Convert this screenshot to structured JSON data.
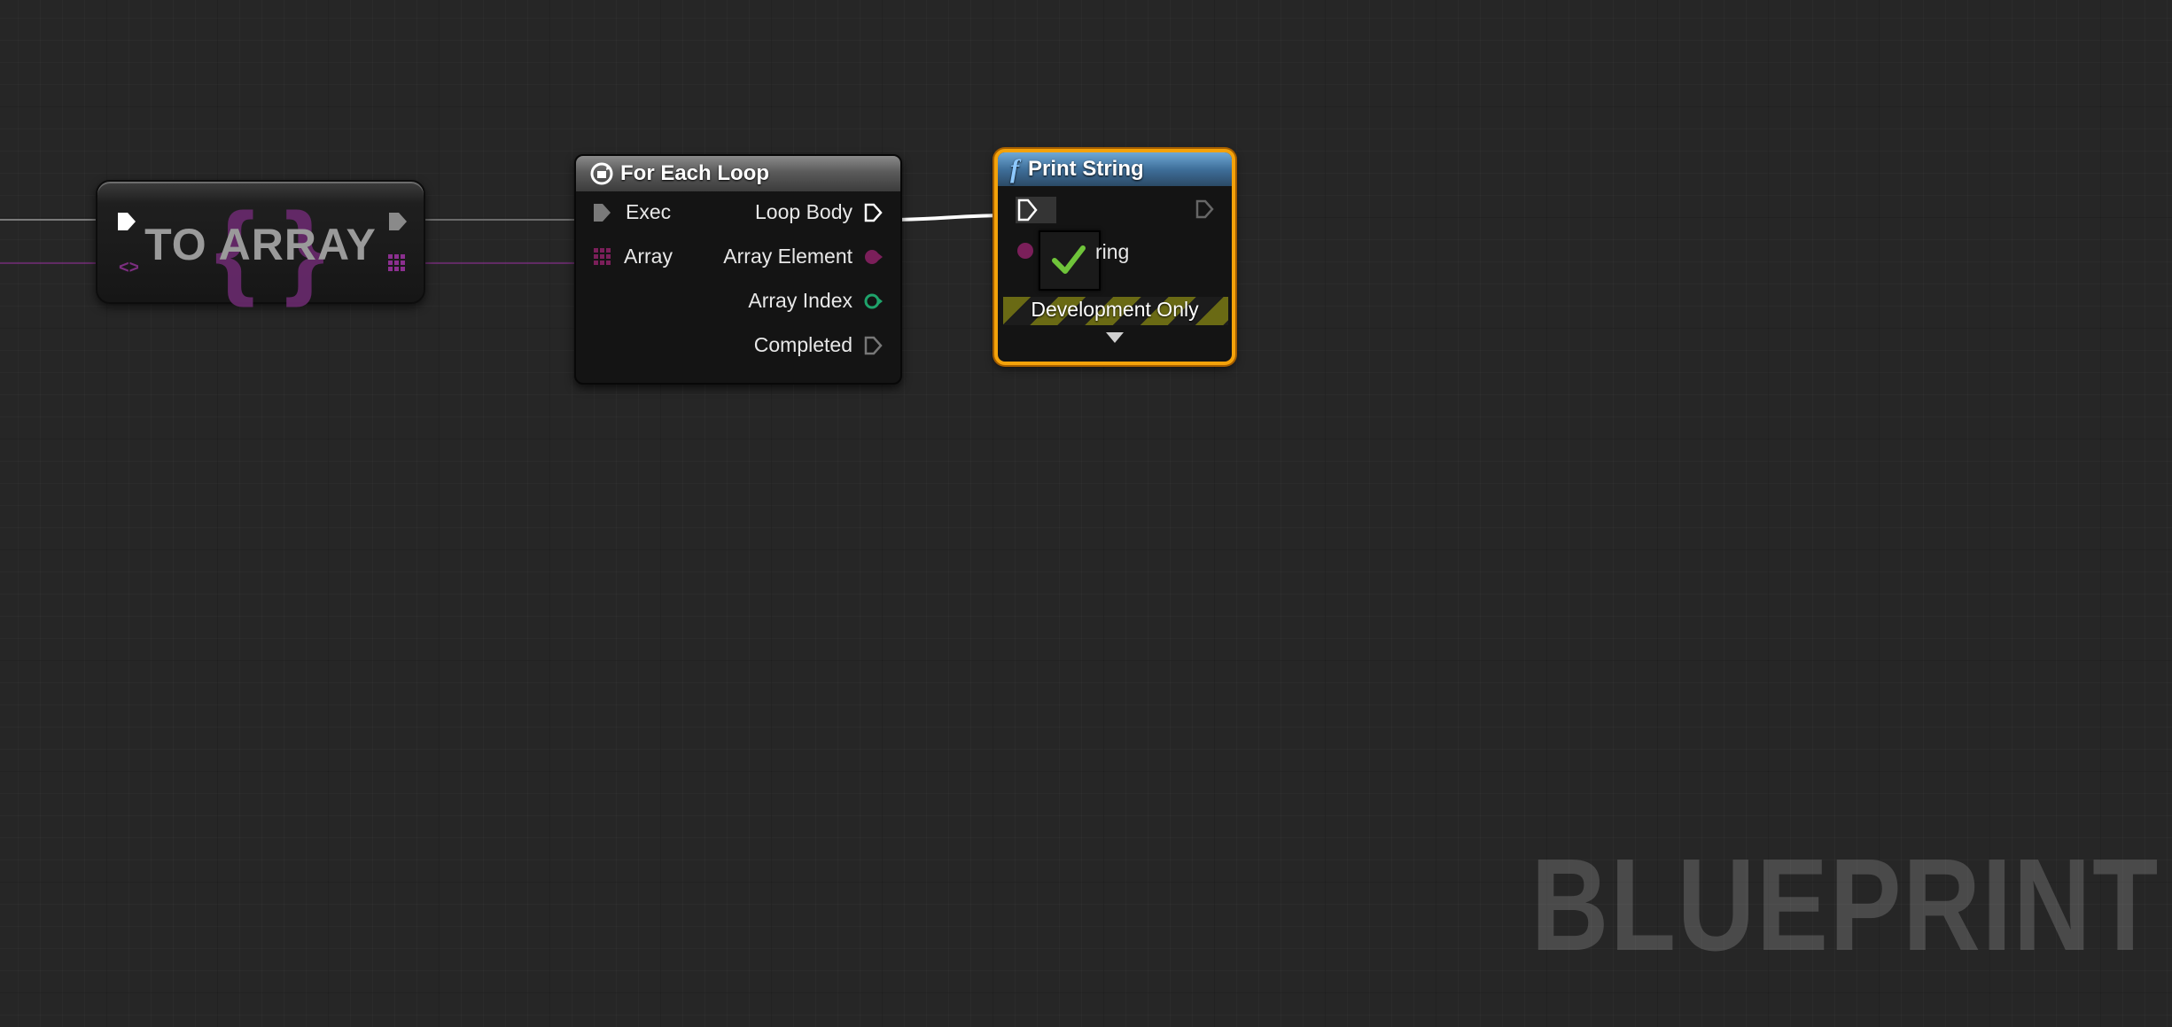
{
  "graph": {
    "watermark": "BLUEPRINT",
    "colors": {
      "background": "#262626",
      "exec_wire": "#ffffff",
      "array_wire": "#7b2e7f",
      "wildcard_pin": "#7b1f5a",
      "integer_pin": "#1fa36b",
      "selection": "#f4a20a",
      "function_header": "#3f6f9a"
    }
  },
  "nodes": {
    "to_array": {
      "title": "TO ARRAY"
    },
    "for_each_loop": {
      "title": "For Each Loop",
      "inputs": {
        "exec": "Exec",
        "array": "Array"
      },
      "outputs": {
        "loop_body": "Loop Body",
        "array_element": "Array Element",
        "array_index": "Array Index",
        "completed": "Completed"
      }
    },
    "print_string": {
      "title": "Print String",
      "string_pin_partial": "ring",
      "dev_label": "Development Only",
      "selected": true
    }
  }
}
